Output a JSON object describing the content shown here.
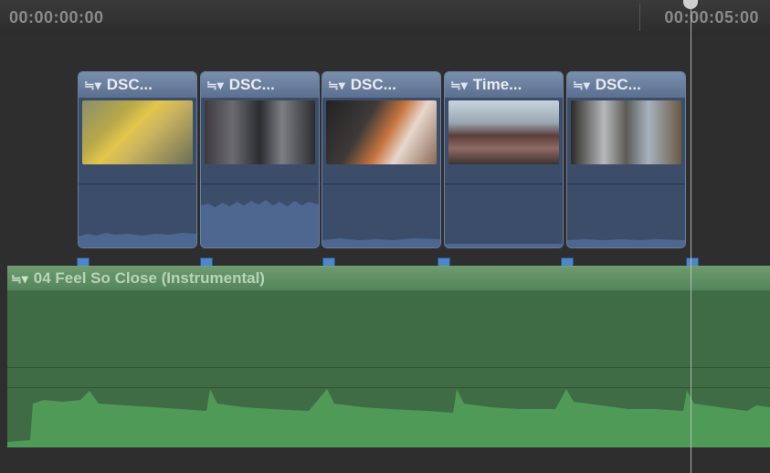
{
  "timeline": {
    "start_timecode": "00:00:00:00",
    "end_timecode": "00:00:05:00"
  },
  "video_clips": [
    {
      "title": "DSC..."
    },
    {
      "title": "DSC..."
    },
    {
      "title": "DSC..."
    },
    {
      "title": "Time..."
    },
    {
      "title": "DSC..."
    }
  ],
  "audio_clip": {
    "title": "04 Feel So Close (Instrumental)"
  },
  "icons": {
    "clip_menu": "≒▾"
  },
  "colors": {
    "video_clip": "#3b4d68",
    "audio_clip": "#3f6c44",
    "marker": "#4e87c9"
  }
}
